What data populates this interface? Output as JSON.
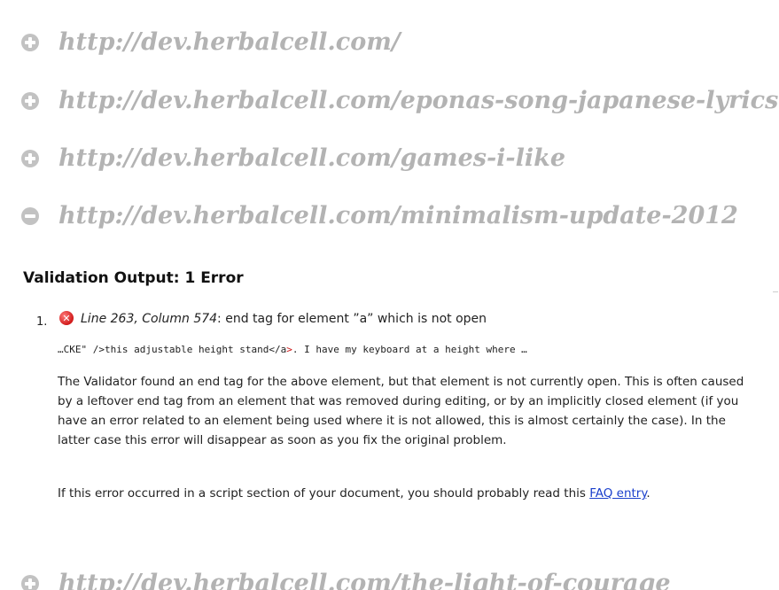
{
  "urls": [
    {
      "text": "http://dev.herbalcell.com/",
      "state": "collapsed",
      "icon": "plus-circle-icon"
    },
    {
      "text": "http://dev.herbalcell.com/eponas-song-japanese-lyrics",
      "state": "collapsed",
      "icon": "plus-circle-icon"
    },
    {
      "text": "http://dev.herbalcell.com/games-i-like",
      "state": "collapsed",
      "icon": "plus-circle-icon"
    },
    {
      "text": "http://dev.herbalcell.com/minimalism-update-2012",
      "state": "expanded",
      "icon": "minus-circle-icon"
    },
    {
      "text": "http://dev.herbalcell.com/the-light-of-courage",
      "state": "collapsed",
      "icon": "plus-circle-icon"
    }
  ],
  "validation": {
    "heading": "Validation Output: 1 Error",
    "errors": [
      {
        "number": "1.",
        "icon": "error-x-icon",
        "location": "Line 263, Column 574",
        "message": ": end tag for element ”a” which is not open",
        "source_before": "…CKE\" />this adjustable height stand</a",
        "source_highlight": ">",
        "source_after": ". I have my keyboard at a height where …",
        "explanation": "The Validator found an end tag for the above element, but that element is not currently open. This is often caused by a leftover end tag from an element that was removed during editing, or by an implicitly closed element (if you have an error related to an element being used where it is not allowed, this is almost certainly the case). In the latter case this error will disappear as soon as you fix the original problem.",
        "script_note_before": "If this error occurred in a script section of your document, you should probably read this ",
        "faq_link_text": "FAQ entry",
        "script_note_after": "."
      }
    ]
  },
  "colors": {
    "url_text": "#b3b3b3",
    "toggle_icon": "#c2c2c2",
    "error_icon": "#d11a1a",
    "link": "#1a3fcc",
    "source_highlight": "#cc1111"
  }
}
